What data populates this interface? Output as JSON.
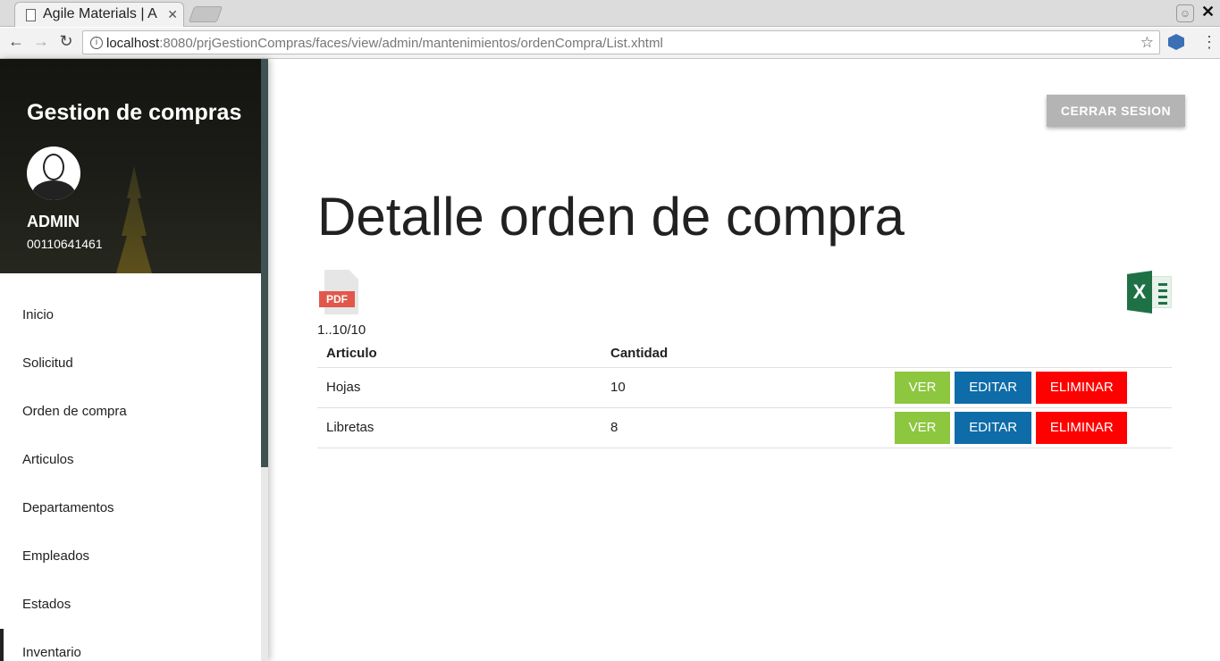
{
  "browser": {
    "tab_title": "Agile Materials | A",
    "url_host": "localhost",
    "url_rest": ":8080/prjGestionCompras/faces/view/admin/mantenimientos/ordenCompra/List.xhtml"
  },
  "sidebar": {
    "brand": "Gestion de compras",
    "user_name": "ADMIN",
    "user_id": "00110641461",
    "items": [
      {
        "label": "Inicio"
      },
      {
        "label": "Solicitud"
      },
      {
        "label": "Orden de compra"
      },
      {
        "label": "Articulos"
      },
      {
        "label": "Departamentos"
      },
      {
        "label": "Empleados"
      },
      {
        "label": "Estados"
      },
      {
        "label": "Inventario"
      }
    ]
  },
  "main": {
    "logout_label": "CERRAR SESION",
    "title": "Detalle orden de compra",
    "pdf_label": "PDF",
    "xls_label": "X",
    "paginator": "1..10/10",
    "table": {
      "headers": [
        "Articulo",
        "Cantidad"
      ],
      "rows": [
        {
          "articulo": "Hojas",
          "cantidad": "10"
        },
        {
          "articulo": "Libretas",
          "cantidad": "8"
        }
      ],
      "actions": {
        "ver": "VER",
        "editar": "EDITAR",
        "eliminar": "ELIMINAR"
      }
    }
  },
  "colors": {
    "ver": "#8dc63f",
    "editar": "#0e6ca8",
    "eliminar": "#ff0000",
    "logout": "#b4b4b4",
    "scrollbar": "#3f5152"
  },
  "icons": [
    "page-icon",
    "info-icon",
    "star-icon",
    "extension-icon",
    "menu-icon",
    "pdf-icon",
    "excel-icon",
    "avatar-icon"
  ]
}
